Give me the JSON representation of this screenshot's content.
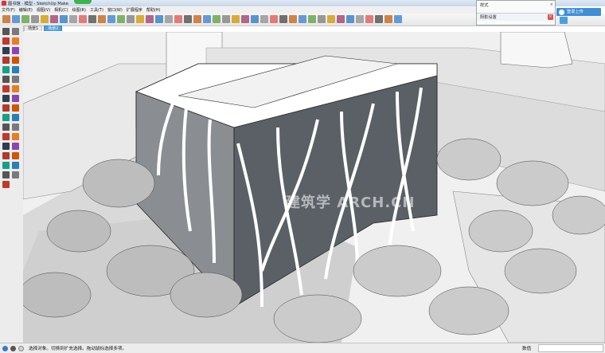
{
  "window": {
    "title": "图书馆 · 模型 - SketchUp Make"
  },
  "menu": {
    "items": [
      "文件(F)",
      "编辑(E)",
      "视图(V)",
      "相机(C)",
      "绘图(R)",
      "工具(T)",
      "窗口(W)",
      "扩展程序",
      "帮助(H)"
    ]
  },
  "scenes": {
    "tabs": [
      "场景1",
      "场景2"
    ]
  },
  "tray": {
    "header": "样式",
    "panel_row": "阴影设置",
    "close_glyph": "×"
  },
  "account": {
    "signin_label": "登录上传"
  },
  "status": {
    "message": "选择对象。切换到扩充选择。拖动鼠标选择多项。",
    "measure_label": "数值",
    "measure_value": ""
  },
  "watermark": {
    "text": "建筑学 ARCH.CN"
  },
  "icons": {
    "toolbar": [
      "select",
      "component",
      "paint",
      "eraser",
      "rect",
      "line",
      "arc",
      "pushpull",
      "move",
      "rotate",
      "scale",
      "offset",
      "tape",
      "text",
      "axes",
      "3dtext",
      "orbit",
      "pan",
      "zoom",
      "zoomext",
      "prev",
      "next",
      "iso",
      "top",
      "front",
      "right",
      "back",
      "left",
      "xray",
      "backedge",
      "wire",
      "hidden",
      "shaded",
      "textured",
      "mono",
      "section",
      "sectiondisp",
      "sectioncut",
      "warehouse",
      "share",
      "extension",
      "layout"
    ],
    "left_tools": [
      "select-icon",
      "make-component-icon",
      "eraser-icon",
      "paint-icon",
      "line-icon",
      "freehand-icon",
      "rectangle-icon",
      "rotated-rect-icon",
      "circle-icon",
      "polygon-icon",
      "arc-icon",
      "pie-icon",
      "move-icon",
      "pushpull-icon",
      "rotate-icon",
      "followme-icon",
      "scale-icon",
      "offset-icon",
      "tape-icon",
      "dimension-icon",
      "protractor-icon",
      "text-icon",
      "axes-icon",
      "3dtext-icon",
      "orbit-icon",
      "pan-icon",
      "zoom-icon",
      "zoom-window-icon",
      "zoom-extents-icon",
      "position-camera-icon",
      "look-around-icon",
      "walk-icon",
      "section-icon"
    ]
  },
  "colors": {
    "accent": "#4a9fe0",
    "close_red": "#d9534f",
    "brand_green": "#39b54a"
  }
}
